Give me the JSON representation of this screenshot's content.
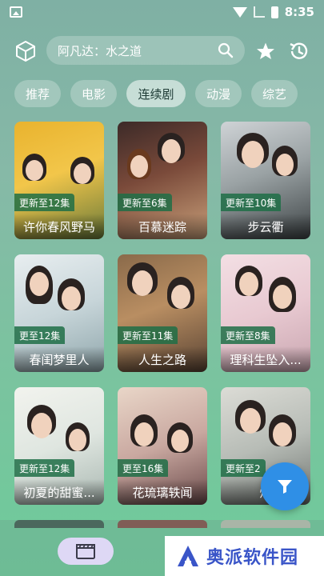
{
  "status_bar": {
    "time": "8:35"
  },
  "search": {
    "text": "阿凡达：水之道"
  },
  "tabs": [
    {
      "label": "推荐",
      "active": false
    },
    {
      "label": "电影",
      "active": false
    },
    {
      "label": "连续剧",
      "active": true
    },
    {
      "label": "动漫",
      "active": false
    },
    {
      "label": "综艺",
      "active": false
    }
  ],
  "cards": [
    {
      "badge": "更新至12集",
      "title": "许你春风野马"
    },
    {
      "badge": "更新至6集",
      "title": "百慕迷踪"
    },
    {
      "badge": "更新至10集",
      "title": "步云衢"
    },
    {
      "badge": "更至12集",
      "title": "春闺梦里人"
    },
    {
      "badge": "更新至11集",
      "title": "人生之路"
    },
    {
      "badge": "更新至8集",
      "title": "理科生坠入..."
    },
    {
      "badge": "更新至12集",
      "title": "初夏的甜蜜..."
    },
    {
      "badge": "更至16集",
      "title": "花琉璃轶闻"
    },
    {
      "badge": "更新至2",
      "title": "烟"
    }
  ],
  "watermark": {
    "text": "奥派软件园"
  },
  "colors": {
    "fab": "#2f8fe6",
    "tab_active_text": "#1f3c36",
    "badge": "#1e6e46",
    "watermark": "#3a55c8"
  },
  "icons": [
    "cube-icon",
    "search-icon",
    "star-icon",
    "history-icon",
    "filter-icon",
    "clapperboard-icon"
  ]
}
